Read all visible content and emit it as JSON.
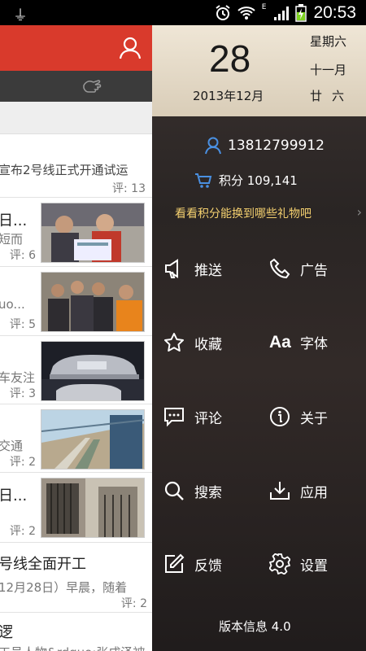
{
  "status_bar": {
    "time": "20:53",
    "network": "E",
    "icons": [
      "usb-icon",
      "alarm-icon",
      "wifi-icon",
      "signal-icon",
      "battery-charging-icon"
    ]
  },
  "feed": {
    "items": [
      {
        "title": "宣布2号线正式开通试运",
        "comment": "评: 13"
      },
      {
        "title": "日...",
        "subtitle": "短而",
        "comment": "评: 6"
      },
      {
        "title": "",
        "subtitle": "uo...",
        "comment": "评: 5"
      },
      {
        "title": "",
        "subtitle": "车友注",
        "comment": "评: 3"
      },
      {
        "title": "",
        "subtitle": "交通",
        "comment": "评: 2"
      },
      {
        "title": "日...",
        "subtitle": "",
        "comment": "评: 2"
      },
      {
        "title": "号线全面开工",
        "subtitle": "12月28日）早晨，随着",
        "comment": "评: 2"
      },
      {
        "title": "逻",
        "subtitle": "工号人物&rdquo;张成泽被",
        "comment": ""
      }
    ]
  },
  "drawer": {
    "date": {
      "day": "28",
      "year_month": "2013年12月",
      "weekday": "星期六",
      "lunar_month": "十一月",
      "lunar_day": "廿六"
    },
    "account": {
      "phone": "13812799912",
      "points": "积分 109,141",
      "gift_link": "看看积分能换到哪些礼物吧"
    },
    "menu": {
      "push": "推送",
      "ads": "广告",
      "favorites": "收藏",
      "font": "字体",
      "comments": "评论",
      "about": "关于",
      "search": "搜索",
      "apps": "应用",
      "feedback": "反馈",
      "settings": "设置"
    },
    "version": "版本信息  4.0"
  },
  "colors": {
    "brand_red": "#d93a2c",
    "accent_blue": "#4a90e2",
    "gift_yellow": "#f4d06f"
  }
}
